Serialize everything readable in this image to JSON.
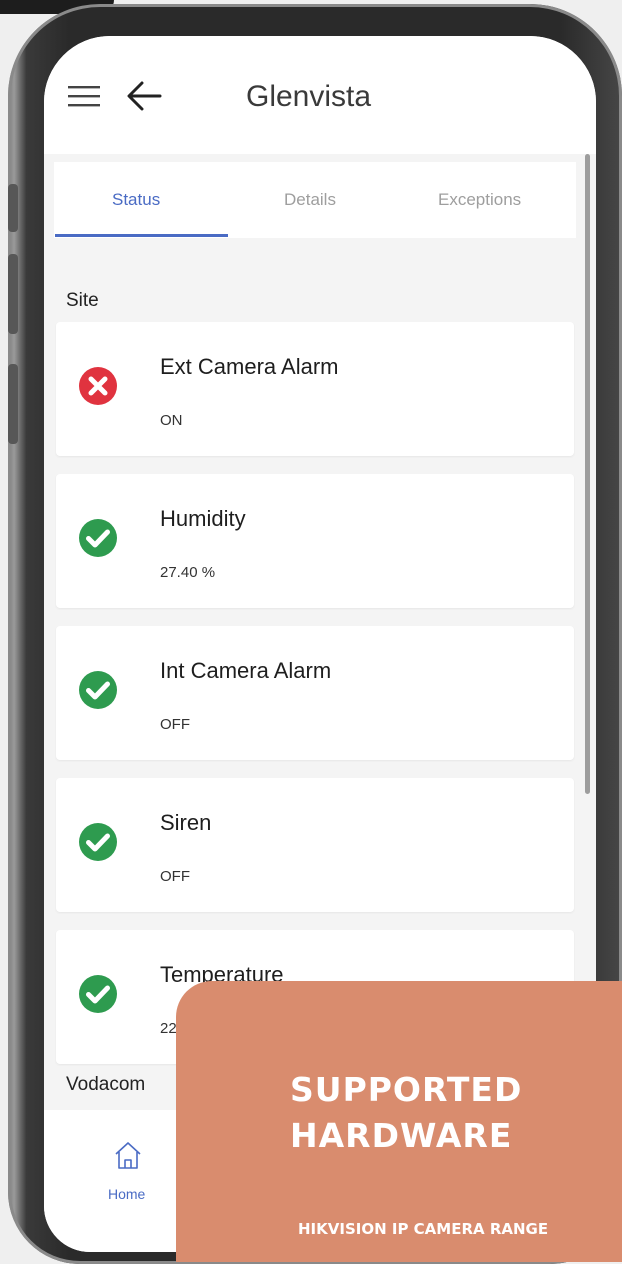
{
  "app": {
    "title": "Glenvista"
  },
  "tabs": [
    {
      "label": "Status",
      "active": true
    },
    {
      "label": "Details",
      "active": false
    },
    {
      "label": "Exceptions",
      "active": false
    }
  ],
  "groups": {
    "site": "Site",
    "vodacom": "Vodacom"
  },
  "items": [
    {
      "name": "Ext Camera Alarm",
      "value": "ON",
      "state": "alarm",
      "icon": "error-icon"
    },
    {
      "name": "Humidity",
      "value": "27.40 %",
      "state": "ok",
      "icon": "check-icon"
    },
    {
      "name": "Int Camera Alarm",
      "value": "OFF",
      "state": "ok",
      "icon": "check-icon"
    },
    {
      "name": "Siren",
      "value": "OFF",
      "state": "ok",
      "icon": "check-icon"
    },
    {
      "name": "Temperature",
      "value": "22",
      "state": "ok",
      "icon": "check-icon"
    }
  ],
  "nav": {
    "home": "Home"
  },
  "promo": {
    "title": "SUPPORTED HARDWARE",
    "subtitle": "HIKVISION IP CAMERA RANGE"
  },
  "colors": {
    "accent": "#4a6bc4",
    "ok": "#2e9b4f",
    "alarm": "#e0333f",
    "promo_bg": "#d98c6e"
  }
}
